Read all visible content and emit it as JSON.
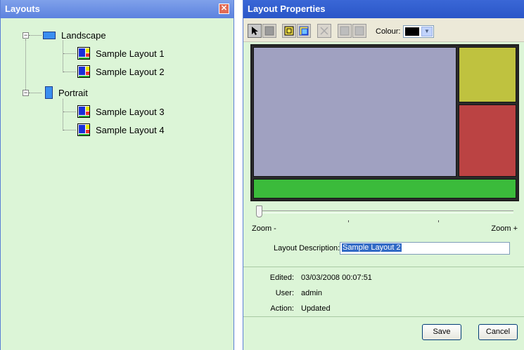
{
  "layouts_panel": {
    "title": "Layouts",
    "close_glyph": "✕",
    "tree": [
      {
        "label": "Landscape",
        "icon": "landscape-icon",
        "expander": "−",
        "children": [
          {
            "label": "Sample Layout 1"
          },
          {
            "label": "Sample Layout 2"
          }
        ]
      },
      {
        "label": "Portrait",
        "icon": "portrait-icon",
        "expander": "−",
        "children": [
          {
            "label": "Sample Layout 3"
          },
          {
            "label": "Sample Layout 4"
          }
        ]
      }
    ]
  },
  "properties_panel": {
    "title": "Layout Properties",
    "toolbar": {
      "buttons": [
        "pointer-icon",
        "region-icon",
        "single-region-icon",
        "split-region-icon",
        "delete-icon",
        "bring-forward-icon",
        "send-back-icon"
      ],
      "colour_label": "Colour:",
      "colour_value": "#000000"
    },
    "canvas_regions": [
      {
        "name": "region-main",
        "color": "#a0a1c1"
      },
      {
        "name": "region-top-right",
        "color": "#bfc23f"
      },
      {
        "name": "region-bottom-right",
        "color": "#bb4343"
      },
      {
        "name": "region-footer",
        "color": "#3bbb3b"
      }
    ],
    "zoom": {
      "min_label": "Zoom -",
      "max_label": "Zoom +",
      "value": 0
    },
    "description_label": "Layout Description:",
    "description_value": "Sample Layout 2",
    "edited_label": "Edited:",
    "edited_value": "03/03/2008 00:07:51",
    "user_label": "User:",
    "user_value": "admin",
    "action_label": "Action:",
    "action_value": "Updated",
    "save_label": "Save",
    "cancel_label": "Cancel"
  }
}
